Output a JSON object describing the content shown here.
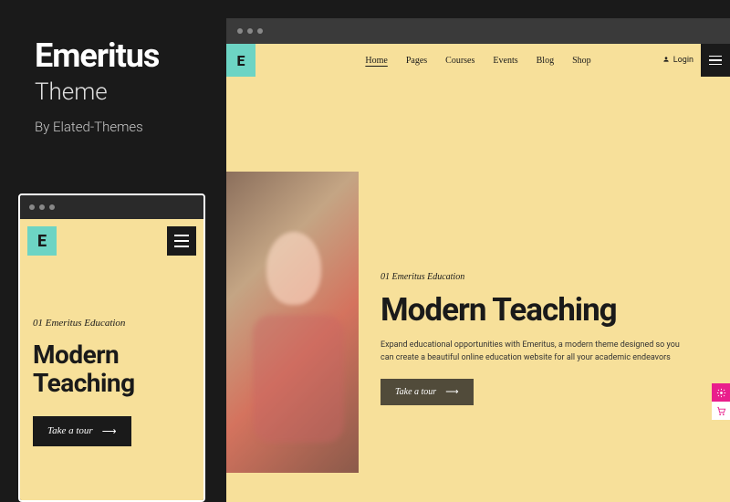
{
  "sidebar": {
    "title": "Emeritus",
    "subtitle": "Theme",
    "byline": "By Elated-Themes"
  },
  "logo_letter": "E",
  "mobile": {
    "eyebrow": "01 Emeritus Education",
    "headline": "Modern Teaching",
    "cta_label": "Take a tour"
  },
  "desktop": {
    "nav": {
      "home": "Home",
      "pages": "Pages",
      "courses": "Courses",
      "events": "Events",
      "blog": "Blog",
      "shop": "Shop"
    },
    "login_label": "Login",
    "eyebrow": "01 Emeritus Education",
    "headline": "Modern Teaching",
    "body": "Expand educational opportunities with Emeritus, a modern theme designed so you can create a beautiful online education website for all your academic endeavors",
    "cta_label": "Take a tour"
  },
  "colors": {
    "bg": "#1a1a1a",
    "cream": "#f7e09a",
    "teal": "#6dd4c4",
    "pink": "#e91e8c"
  }
}
